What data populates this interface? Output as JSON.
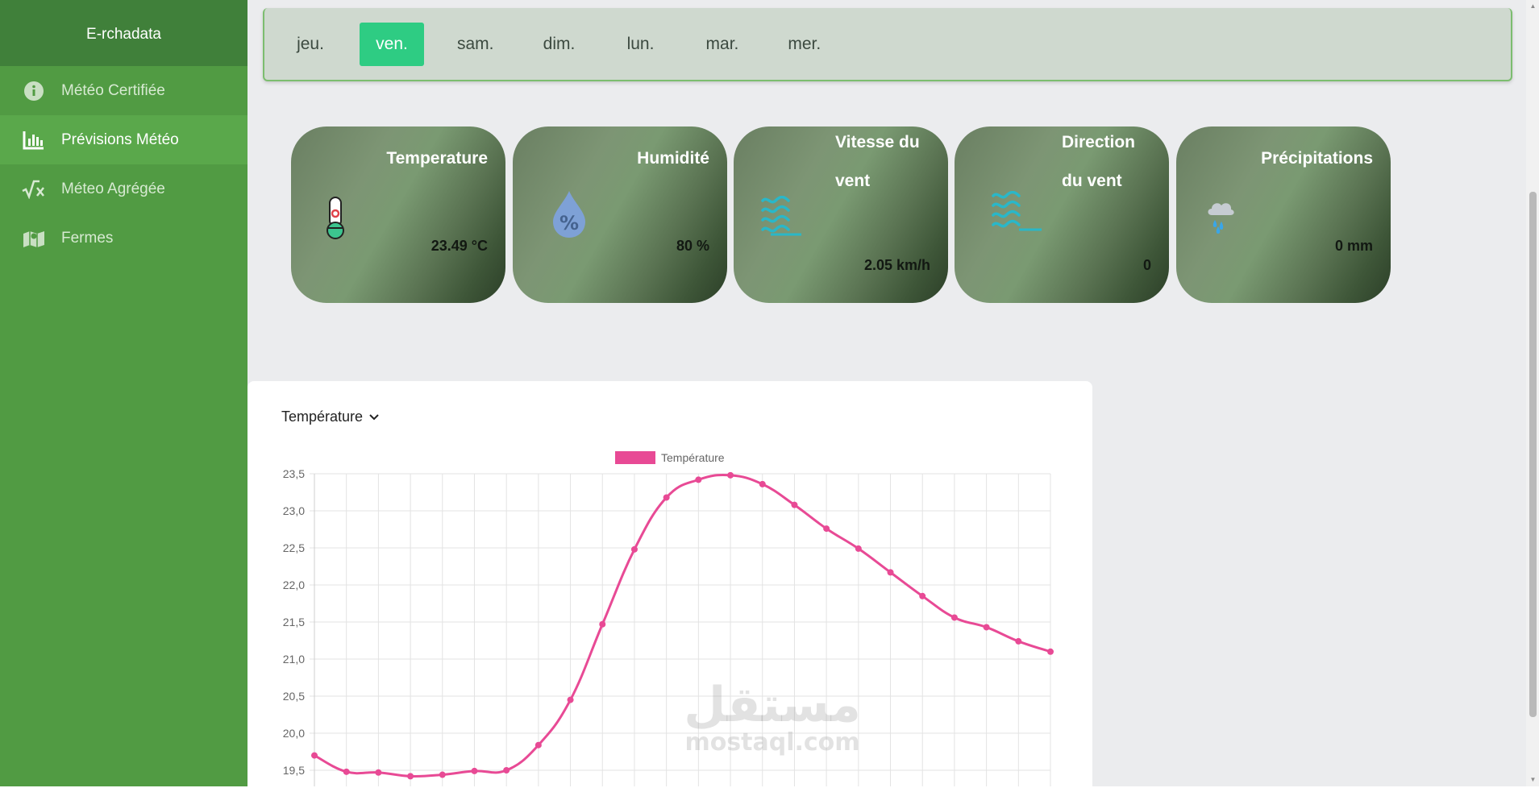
{
  "sidebar": {
    "brand": "E-rchadata",
    "items": [
      {
        "label": "Météo Certifiée",
        "icon": "info-circle-icon",
        "active": false
      },
      {
        "label": "Prévisions Météo",
        "icon": "bar-chart-icon",
        "active": true
      },
      {
        "label": "Méteo Agrégée",
        "icon": "square-root-icon",
        "active": false
      },
      {
        "label": "Fermes",
        "icon": "map-icon",
        "active": false
      }
    ]
  },
  "days": {
    "items": [
      "jeu.",
      "ven.",
      "sam.",
      "dim.",
      "lun.",
      "mar.",
      "mer."
    ],
    "active": "ven."
  },
  "cards": {
    "temperature": {
      "title": "Temperature",
      "value": "23.49 °C",
      "icon": "thermometer-icon"
    },
    "humidity": {
      "title": "Humidité",
      "value": "80 %",
      "icon": "humidity-drop-icon"
    },
    "wind_speed": {
      "title_line1": "Vitesse du",
      "title_line2": "vent",
      "value": "2.05 km/h",
      "icon": "wind-waves-icon"
    },
    "wind_direction": {
      "title_line1": "Direction",
      "title_line2": "du vent",
      "value": "0",
      "icon": "wind-direction-icon"
    },
    "precipitation": {
      "title": "Précipitations",
      "value": "0 mm",
      "icon": "rain-cloud-icon"
    }
  },
  "chart_selector": {
    "label": "Température",
    "icon": "chevron-down-icon"
  },
  "chart_data": {
    "type": "line",
    "legend": "Température",
    "color": "#e84a95",
    "y_ticks": [
      "23,5",
      "23,0",
      "22,5",
      "22,0",
      "21,5",
      "21,0",
      "20,5",
      "20,0",
      "19,5"
    ],
    "ylim": [
      19.5,
      23.5
    ],
    "values": [
      19.7,
      19.48,
      19.47,
      19.42,
      19.44,
      19.49,
      19.5,
      19.84,
      20.45,
      21.47,
      22.48,
      23.18,
      23.42,
      23.48,
      23.36,
      23.08,
      22.76,
      22.49,
      22.17,
      21.85,
      21.56,
      21.43,
      21.24,
      21.1
    ],
    "grid": true,
    "legend_position": "top"
  },
  "watermark": {
    "arabic": "مستقل",
    "latin": "mostaql.com"
  }
}
